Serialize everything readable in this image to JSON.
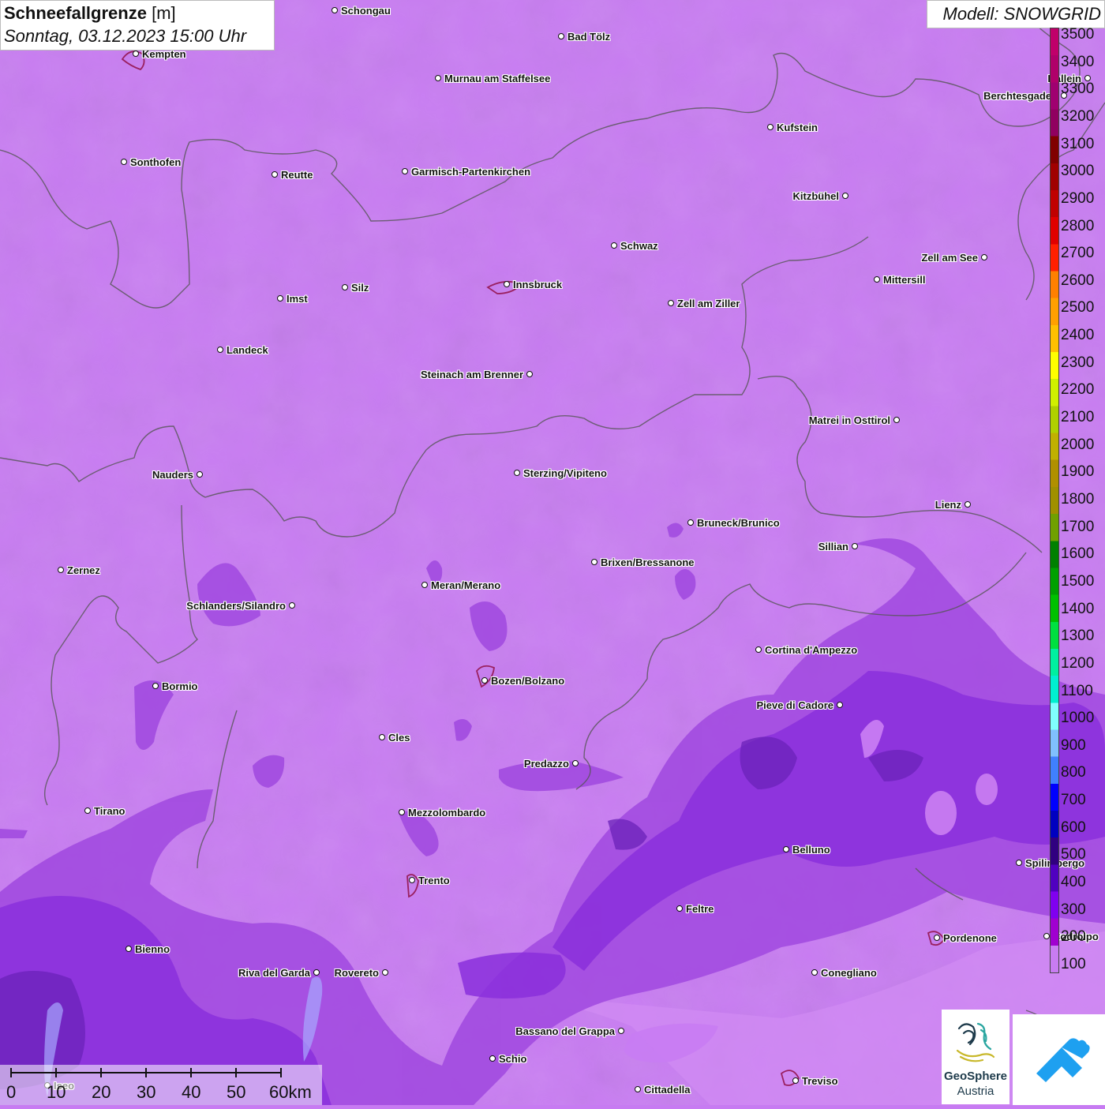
{
  "title": {
    "parameter": "Schneefallgrenze",
    "unit": "[m]",
    "datetime": "Sonntag, 03.12.2023 15:00 Uhr"
  },
  "model": "Modell: SNOWGRID",
  "legend": {
    "labels": [
      "3500",
      "3400",
      "3300",
      "3200",
      "3100",
      "3000",
      "2900",
      "2800",
      "2700",
      "2600",
      "2500",
      "2400",
      "2300",
      "2200",
      "2100",
      "2000",
      "1900",
      "1800",
      "1700",
      "1600",
      "1500",
      "1400",
      "1300",
      "1200",
      "1100",
      "1000",
      "900",
      "800",
      "700",
      "600",
      "500",
      "400",
      "300",
      "200",
      "100"
    ],
    "colors": [
      "#c0006a",
      "#b0006a",
      "#a00070",
      "#900060",
      "#800000",
      "#a00000",
      "#c00000",
      "#e00000",
      "#ff2000",
      "#ff8000",
      "#ffa000",
      "#ffc000",
      "#ffff00",
      "#d0f000",
      "#b0d000",
      "#c0b000",
      "#b09000",
      "#a09000",
      "#70a000",
      "#008000",
      "#00a000",
      "#00c000",
      "#00e040",
      "#00f0a0",
      "#00f0d0",
      "#80ffff",
      "#80c0ff",
      "#4080ff",
      "#0000ff",
      "#0000c0",
      "#300080",
      "#5000c0",
      "#8000f0",
      "#a000d0",
      "#c87cf2"
    ]
  },
  "cities": [
    {
      "name": "Schongau"
    },
    {
      "name": "Bad Tölz"
    },
    {
      "name": "Kempten"
    },
    {
      "name": "Murnau am Staffelsee"
    },
    {
      "name": "Hallein"
    },
    {
      "name": "Berchtesgaden"
    },
    {
      "name": "Kufstein"
    },
    {
      "name": "Sonthofen"
    },
    {
      "name": "Reutte"
    },
    {
      "name": "Garmisch-Partenkirchen"
    },
    {
      "name": "Kitzbühel"
    },
    {
      "name": "Schwaz"
    },
    {
      "name": "Zell am See"
    },
    {
      "name": "Mittersill"
    },
    {
      "name": "Innsbruck"
    },
    {
      "name": "Silz"
    },
    {
      "name": "Imst"
    },
    {
      "name": "Zell am Ziller"
    },
    {
      "name": "Landeck"
    },
    {
      "name": "Steinach am Brenner"
    },
    {
      "name": "Matrei in Osttirol"
    },
    {
      "name": "Nauders"
    },
    {
      "name": "Sterzing/Vipiteno"
    },
    {
      "name": "Lienz"
    },
    {
      "name": "Bruneck/Brunico"
    },
    {
      "name": "Sillian"
    },
    {
      "name": "Brixen/Bressanone"
    },
    {
      "name": "Zernez"
    },
    {
      "name": "Meran/Merano"
    },
    {
      "name": "Schlanders/Silandro"
    },
    {
      "name": "Cortina d'Ampezzo"
    },
    {
      "name": "Bozen/Bolzano"
    },
    {
      "name": "Bormio"
    },
    {
      "name": "Pieve di Cadore"
    },
    {
      "name": "Cles"
    },
    {
      "name": "Predazzo"
    },
    {
      "name": "Tirano"
    },
    {
      "name": "Mezzolombardo"
    },
    {
      "name": "Belluno"
    },
    {
      "name": "Spilimbergo"
    },
    {
      "name": "Trento"
    },
    {
      "name": "Feltre"
    },
    {
      "name": "Pordenone"
    },
    {
      "name": "Codroipo"
    },
    {
      "name": "Bienno"
    },
    {
      "name": "Riva del Garda"
    },
    {
      "name": "Rovereto"
    },
    {
      "name": "Conegliano"
    },
    {
      "name": "Bassano del Grappa"
    },
    {
      "name": "Schio"
    },
    {
      "name": "Treviso"
    },
    {
      "name": "Cittadella"
    },
    {
      "name": "Iseo"
    }
  ],
  "scalebar": {
    "labels": [
      "0",
      "10",
      "20",
      "30",
      "40",
      "50",
      "60km"
    ]
  },
  "logos": {
    "geosphere_name": "GeoSphere",
    "geosphere_sub": "Austria"
  }
}
